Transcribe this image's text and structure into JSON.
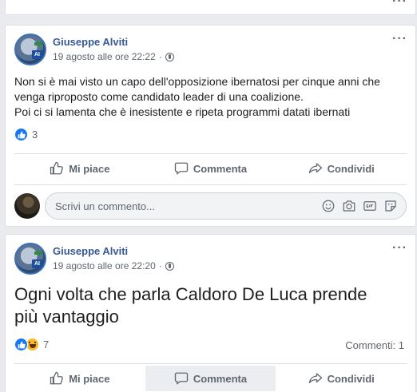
{
  "posts": [
    {
      "author": "Giuseppe Alviti",
      "date": "19 agosto alle ore 22:22",
      "separator": "·",
      "text_lines": [
        "Non si è mai visto un capo dell'opposizione ibernatosi per cinque anni che",
        "venga riproposto come candidato leader di una coalizione.",
        "Poi ci si lamenta che è inesistente e ripeta programmi datati ibernati"
      ],
      "reaction_count": "3",
      "reactions": [
        "like"
      ]
    },
    {
      "author": "Giuseppe Alviti",
      "date": "19 agosto alle ore 22:20",
      "separator": "·",
      "text_lines": [
        "Ogni volta che parla Caldoro De Luca prende",
        "più vantaggio"
      ],
      "reaction_count": "7",
      "reactions": [
        "like",
        "haha"
      ],
      "comments_label": "Commenti: 1"
    }
  ],
  "actions": {
    "like": "Mi piace",
    "comment": "Commenta",
    "share": "Condividi"
  },
  "comment_box": {
    "placeholder": "Scrivi un commento..."
  },
  "avatar_badge": "AI",
  "icons": [
    "more-icon",
    "globe-icon",
    "thumbs-up-icon",
    "comment-icon",
    "share-icon",
    "emoji-icon",
    "camera-icon",
    "gif-icon",
    "sticker-icon"
  ],
  "colors": {
    "author": "#385898",
    "like_blue": "#1877f2",
    "haha_yellow": "#f7b928",
    "muted": "#606770",
    "background": "#e9ebee"
  }
}
